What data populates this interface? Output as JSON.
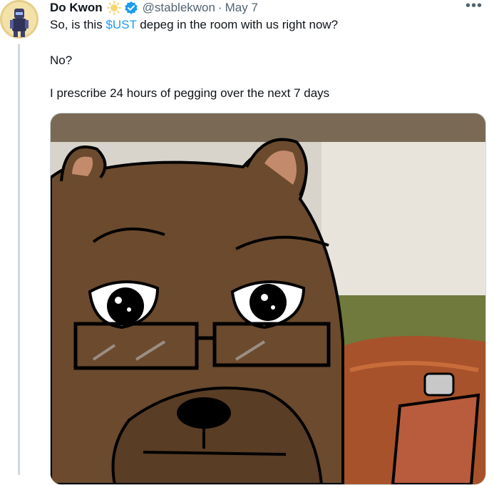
{
  "tweet": {
    "display_name": "Do Kwon",
    "emoji_icon": "sun-emoji-icon",
    "verified_icon": "verified-badge-icon",
    "handle": "@stablekwon",
    "separator": "·",
    "date": "May 7",
    "more_icon": "more-options-icon",
    "text": {
      "line1_prefix": "So, is this ",
      "cashtag": "$UST",
      "line1_suffix": " depeg in the room with us right now?",
      "line2": "No?",
      "line3": "I prescribe 24 hours of pegging over the next 7 days"
    },
    "media_icon": "bear-therapist-image"
  },
  "colors": {
    "link": "#1d9bf0",
    "secondary_text": "#536471",
    "thread_line": "#cfd9de"
  }
}
